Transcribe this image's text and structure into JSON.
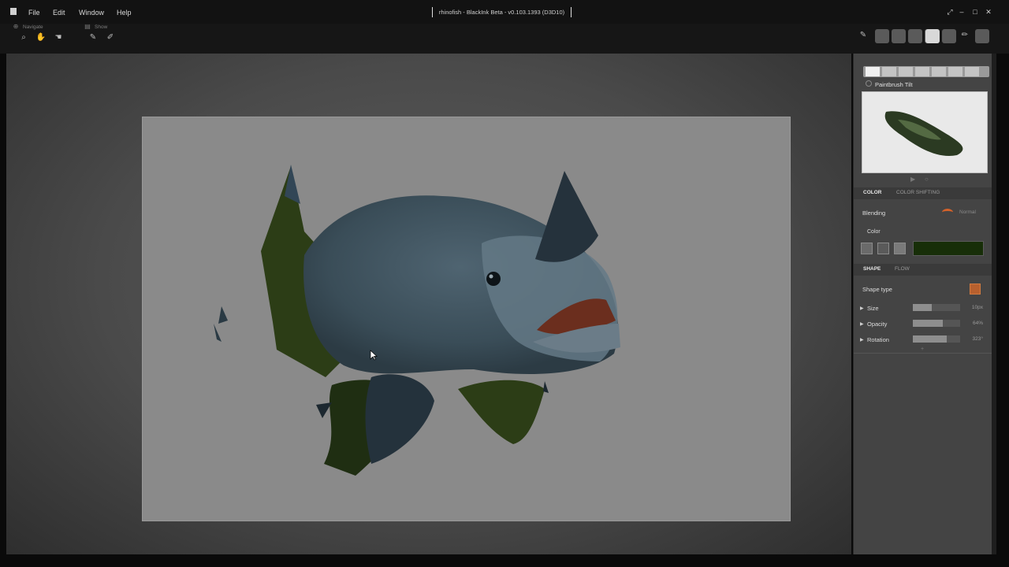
{
  "titlebar": {
    "menu": [
      "File",
      "Edit",
      "Window",
      "Help"
    ],
    "title": "rhinofish - BlackInk Beta - v0.103.1393 (D3D10)"
  },
  "toolbar": {
    "navigate_label": "Navigate",
    "show_label": "Show"
  },
  "panel": {
    "brush_name": "Paintbrush Tilt",
    "color_tab": "COLOR",
    "color_shifting_tab": "COLOR SHIFTING",
    "blending_label": "Blending",
    "blending_mode": "Normal",
    "color_label": "Color",
    "color_value": "#172e08",
    "shape_tab": "SHAPE",
    "flow_tab": "FLOW",
    "shape_type_label": "Shape type",
    "params": [
      {
        "label": "Size",
        "value": "10px",
        "fill": 0.4
      },
      {
        "label": "Opacity",
        "value": "64%",
        "fill": 0.64
      },
      {
        "label": "Rotation",
        "value": "323°",
        "fill": 0.72
      }
    ]
  },
  "colors": {
    "accent": "#d4622a",
    "panel": "#444444",
    "canvas": "#8a8a8a"
  }
}
